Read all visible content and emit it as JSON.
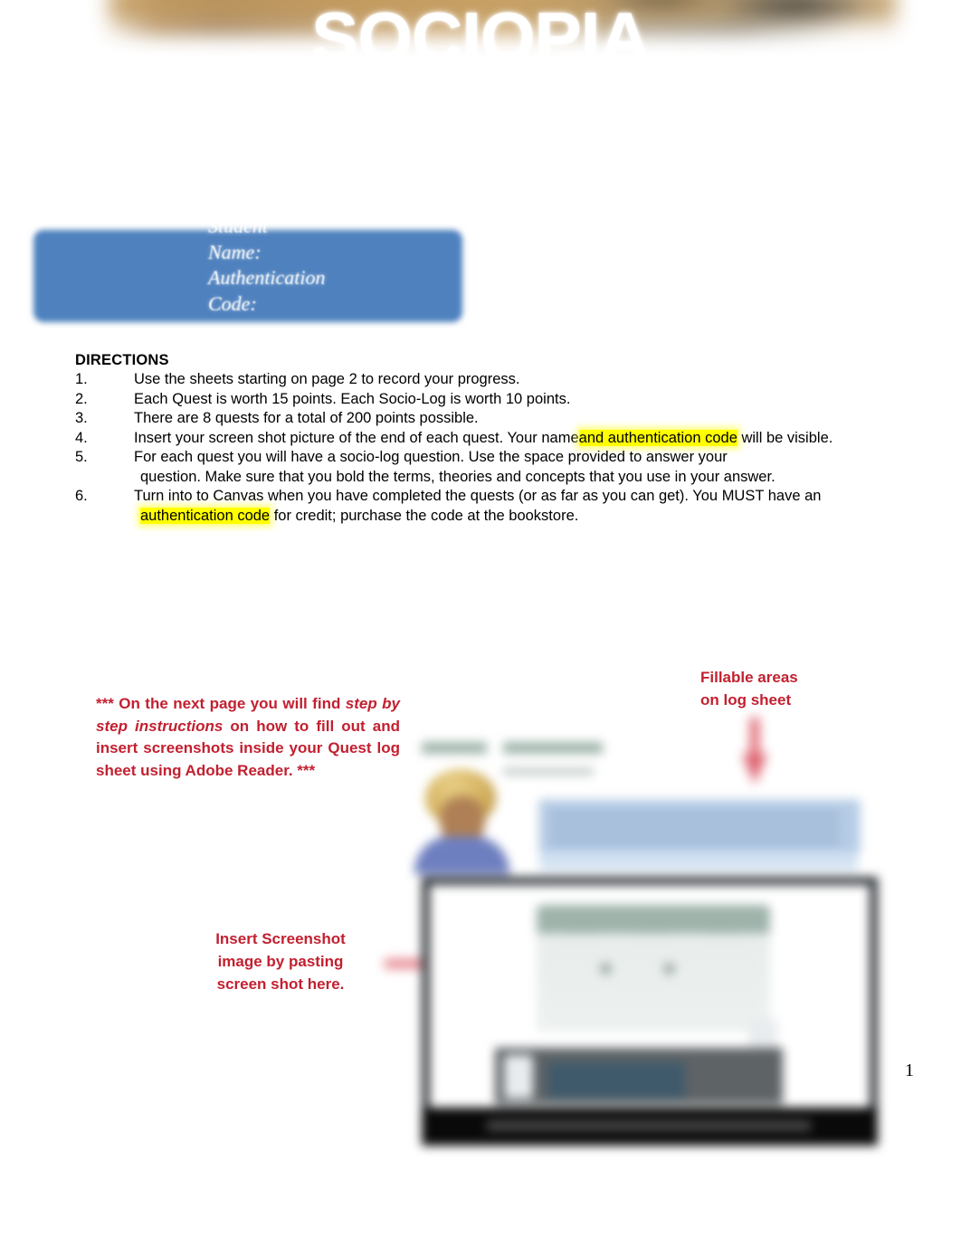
{
  "header": {
    "title": "SOCIOPIA",
    "banner_icon": "blurred-photo-banner"
  },
  "info_box": {
    "fields_text": "Student Name: Authentication Code:",
    "student_name_label": "Student Name:",
    "authentication_code_label": "Authentication Code:",
    "fill_color": "#4E81BE"
  },
  "directions": {
    "heading": "DIRECTIONS",
    "items": [
      {
        "number": "1.",
        "text": "Use the sheets starting on page 2 to record your progress."
      },
      {
        "number": "2.",
        "text": "Each Quest is worth 15 points. Each Socio-Log is worth 10 points."
      },
      {
        "number": "3.",
        "text": "There are 8 quests for a total of 200 points possible."
      },
      {
        "number": "4.",
        "text_before": "Insert your screen shot picture of the end of each quest. Your name",
        "highlight": "and authentication code",
        "text_after": " will be visible."
      },
      {
        "number": "5.",
        "text": "For each quest you will have a socio-log question. Use the space provided to answer your",
        "continuation": "question. Make sure that you bold the terms, theories and concepts that you use in your answer."
      },
      {
        "number": "6.",
        "text": "Turn into to Canvas when you have completed the quests (or as far as you can get). You MUST have an",
        "highlight": "authentication code",
        "continuation_after": " for credit; purchase the code at the bookstore."
      }
    ],
    "highlight_color": "#ffff00"
  },
  "callouts": {
    "accent_color": "#C22030",
    "left": {
      "line1": "*** On the next page you will find ",
      "emphasis": "step by step instructions",
      "line2": " on how to fill out and insert screenshots inside your Quest log  sheet using Adobe Reader. ***"
    },
    "top_right": {
      "line1": "Fillable areas",
      "line2": "on log sheet"
    },
    "insert": {
      "line1": "Insert Screenshot",
      "line2": "image by pasting",
      "line3": "screen shot here."
    }
  },
  "preview": {
    "description": "blurred-log-sheet-preview"
  },
  "footer": {
    "page_number": "1"
  }
}
